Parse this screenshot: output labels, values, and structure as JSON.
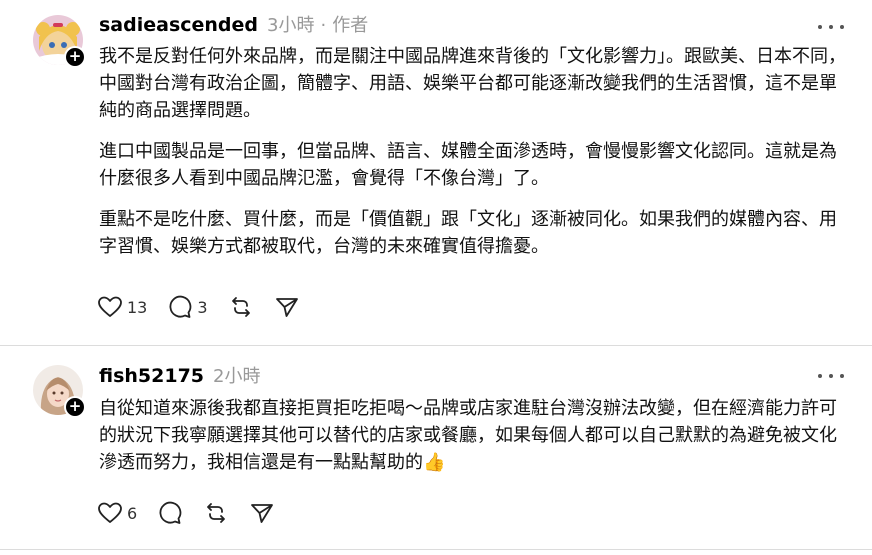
{
  "comments": [
    {
      "username": "sadieascended",
      "time": "3小時",
      "separator": "·",
      "role": "作者",
      "paragraphs": [
        "我不是反對任何外來品牌，而是關注中國品牌進來背後的「文化影響力」。跟歐美、日本不同，中國對台灣有政治企圖，簡體字、用語、娛樂平台都可能逐漸改變我們的生活習慣，這不是單純的商品選擇問題。",
        "進口中國製品是一回事，但當品牌、語言、媒體全面滲透時，會慢慢影響文化認同。這就是為什麼很多人看到中國品牌氾濫，會覺得「不像台灣」了。",
        "重點不是吃什麼、買什麼，而是「價值觀」跟「文化」逐漸被同化。如果我們的媒體內容、用字習慣、娛樂方式都被取代，台灣的未來確實值得擔憂。"
      ],
      "likes": "13",
      "replies": "3",
      "follow_symbol": "+"
    },
    {
      "username": "fish52175",
      "time": "2小時",
      "paragraphs": [
        "自從知道來源後我都直接拒買拒吃拒喝～品牌或店家進駐台灣沒辦法改變，但在經濟能力許可的狀況下我寧願選擇其他可以替代的店家或餐廳，如果每個人都可以自己默默的為避免被文化滲透而努力，我相信還是有一點點幫助的👍"
      ],
      "likes": "6",
      "follow_symbol": "+"
    }
  ],
  "icons": [
    "heart-icon",
    "comment-icon",
    "repost-icon",
    "share-icon",
    "more-icon"
  ]
}
